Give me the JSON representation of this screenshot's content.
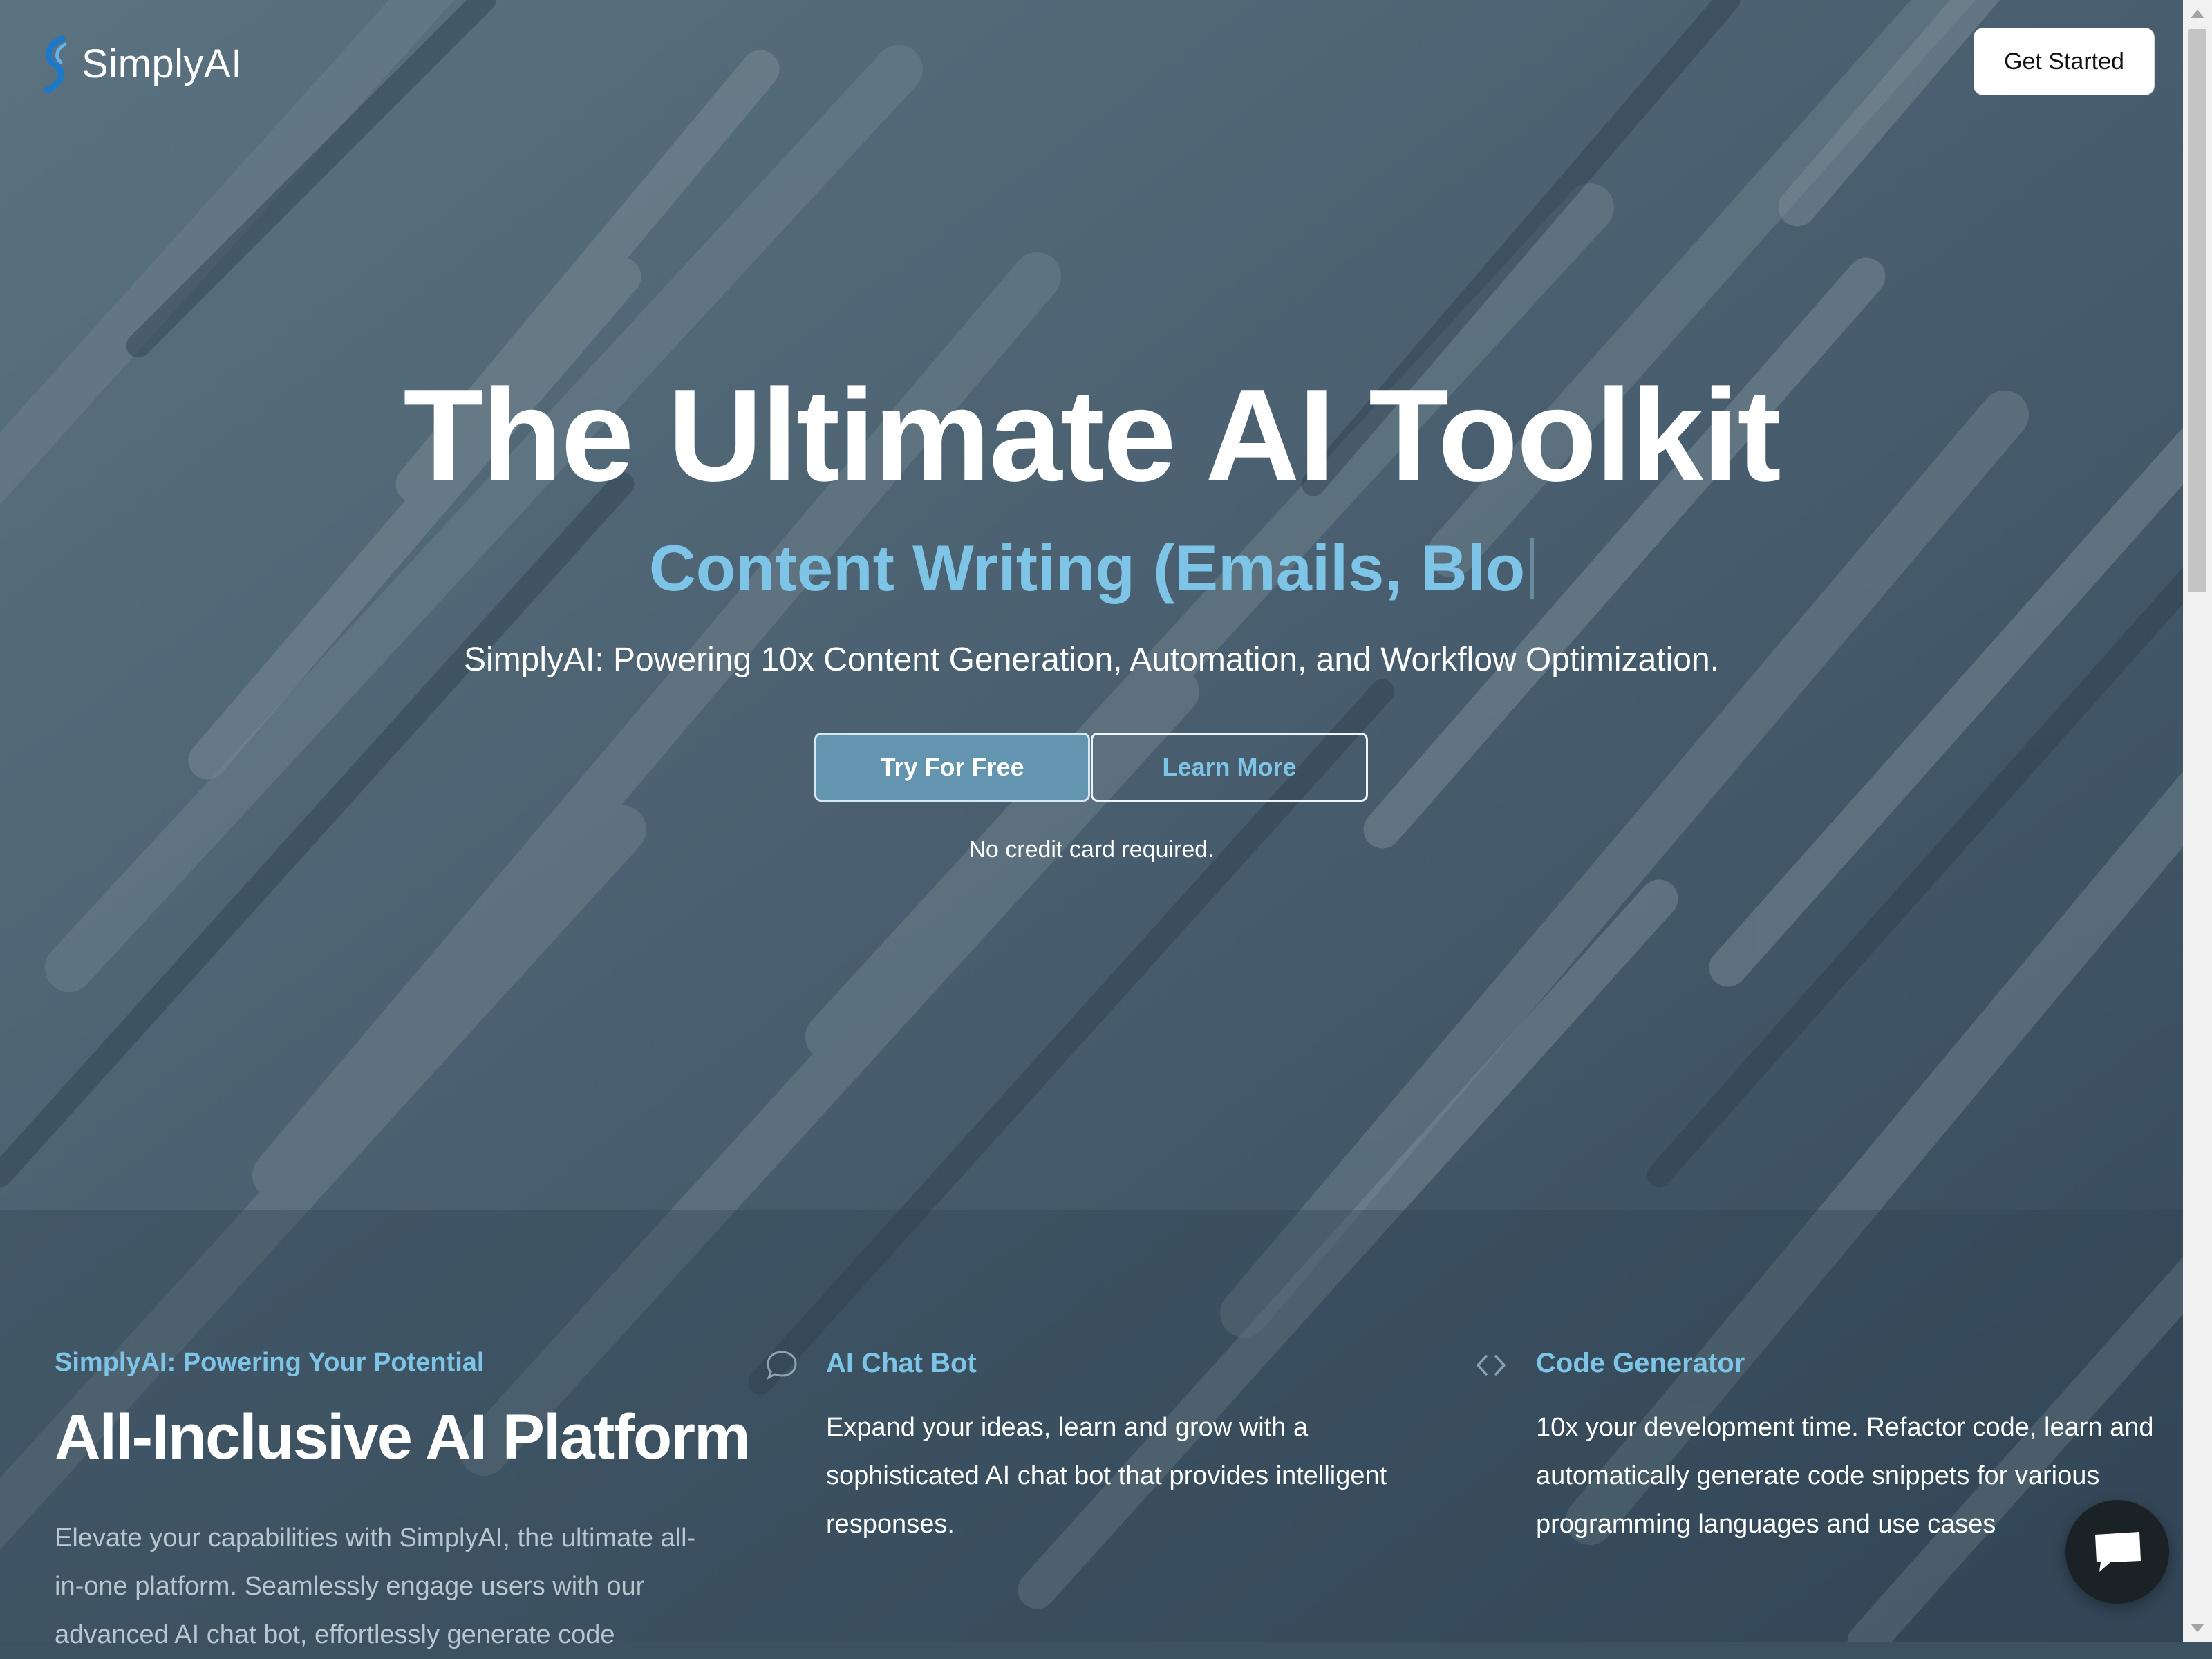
{
  "brand": {
    "name": "SimplyAI"
  },
  "header": {
    "cta_label": "Get Started"
  },
  "hero": {
    "title": "The Ultimate AI Toolkit",
    "typed_text": "Content Writing (Emails, Blo",
    "subtitle": "SimplyAI: Powering 10x Content Generation, Automation, and Workflow Optimization.",
    "primary_button": "Try For Free",
    "secondary_button": "Learn More",
    "note": "No credit card required."
  },
  "features": {
    "kicker": "SimplyAI: Powering Your Potential",
    "title": "All-Inclusive AI Platform",
    "description": "Elevate your capabilities with SimplyAI, the ultimate all-in-one platform. Seamlessly engage users with our advanced AI chat bot, effortlessly generate code",
    "cards": [
      {
        "icon": "chat-bubble-icon",
        "title": "AI Chat Bot",
        "description": "Expand your ideas, learn and grow with a sophisticated AI chat bot that provides intelligent responses."
      },
      {
        "icon": "code-brackets-icon",
        "title": "Code Generator",
        "description": "10x your development time. Refactor code, learn and automatically generate code snippets for various programming languages and use cases"
      }
    ]
  },
  "colors": {
    "accent": "#7ec4e6",
    "primary_button": "#6495b0",
    "background": "#3d5260"
  }
}
